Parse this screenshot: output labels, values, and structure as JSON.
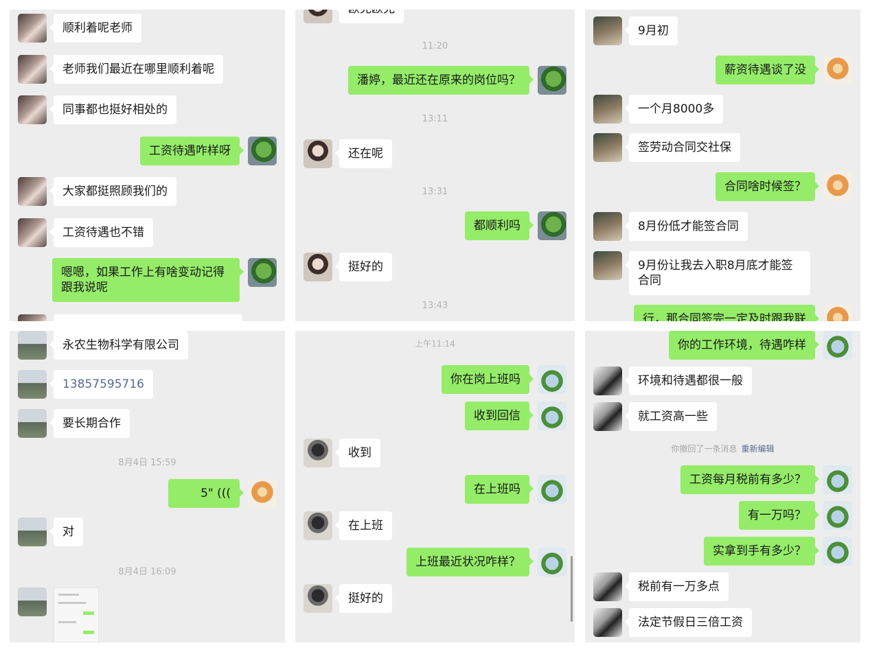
{
  "panels": [
    {
      "id": "p1",
      "messages": [
        {
          "dir": "in",
          "text": "顺利着呢老师"
        },
        {
          "dir": "in",
          "text": "老师我们最近在哪里顺利着呢"
        },
        {
          "dir": "in",
          "text": "同事都也挺好相处的"
        },
        {
          "dir": "out",
          "text": "工资待遇咋样呀"
        },
        {
          "dir": "in",
          "text": "大家都挺照顾我们的"
        },
        {
          "dir": "in",
          "text": "工资待遇也不错"
        },
        {
          "dir": "out",
          "text": "嗯嗯，如果工作上有啥变动记得跟我说呢"
        }
      ]
    },
    {
      "id": "p2",
      "top_partial": "欧克欧克",
      "messages": [
        {
          "ts": "11:20"
        },
        {
          "dir": "out",
          "text": "潘婷，最近还在原来的岗位吗？"
        },
        {
          "ts": "13:11"
        },
        {
          "dir": "in",
          "text": "还在呢"
        },
        {
          "ts": "13:31"
        },
        {
          "dir": "out",
          "text": "都顺利吗"
        },
        {
          "dir": "in",
          "text": "挺好的"
        },
        {
          "ts": "13:43"
        }
      ]
    },
    {
      "id": "p3",
      "messages": [
        {
          "dir": "in",
          "text": "9月初"
        },
        {
          "dir": "out",
          "text": "薪资待遇谈了没"
        },
        {
          "dir": "in",
          "text": "一个月8000多"
        },
        {
          "dir": "in",
          "text": "签劳动合同交社保"
        },
        {
          "dir": "out",
          "text": "合同啥时候签？"
        },
        {
          "dir": "in",
          "text": "8月份低才能签合同"
        },
        {
          "dir": "in",
          "text": "9月份让我去入职8月底才能签合同"
        },
        {
          "dir": "out",
          "text": "行，那合同签完一定及时跟我联"
        }
      ]
    },
    {
      "id": "p4",
      "messages": [
        {
          "dir": "in",
          "text": "永农生物科学有限公司"
        },
        {
          "dir": "in",
          "text": "13857595716",
          "kind": "phone"
        },
        {
          "dir": "in",
          "text": "要长期合作"
        },
        {
          "ts": "8月4日 15:59"
        },
        {
          "dir": "out",
          "text": "5\" (((",
          "kind": "voice"
        },
        {
          "dir": "in",
          "text": "对"
        },
        {
          "ts": "8月4日 16:09"
        }
      ]
    },
    {
      "id": "p5",
      "messages": [
        {
          "ts": "上午11:14"
        },
        {
          "dir": "out",
          "text": "你在岗上班吗"
        },
        {
          "dir": "out",
          "text": "收到回信"
        },
        {
          "dir": "in",
          "text": "收到"
        },
        {
          "dir": "out",
          "text": "在上班吗"
        },
        {
          "dir": "in",
          "text": "在上班"
        },
        {
          "dir": "out",
          "text": "上班最近状况咋样？"
        },
        {
          "dir": "in",
          "text": "挺好的"
        }
      ]
    },
    {
      "id": "p6",
      "messages": [
        {
          "dir": "out",
          "text": "你的工作环境，待遇咋样"
        },
        {
          "dir": "in",
          "text": "环境和待遇都很一般"
        },
        {
          "dir": "in",
          "text": "就工资高一些"
        },
        {
          "sys": "你撤回了一条消息",
          "link": "重新编辑"
        },
        {
          "dir": "out",
          "text": "工资每月税前有多少？"
        },
        {
          "dir": "out",
          "text": "有一万吗？"
        },
        {
          "dir": "out",
          "text": "实拿到手有多少？"
        },
        {
          "dir": "in",
          "text": "税前有一万多点"
        },
        {
          "dir": "in",
          "text": "法定节假日三倍工资"
        }
      ]
    }
  ]
}
